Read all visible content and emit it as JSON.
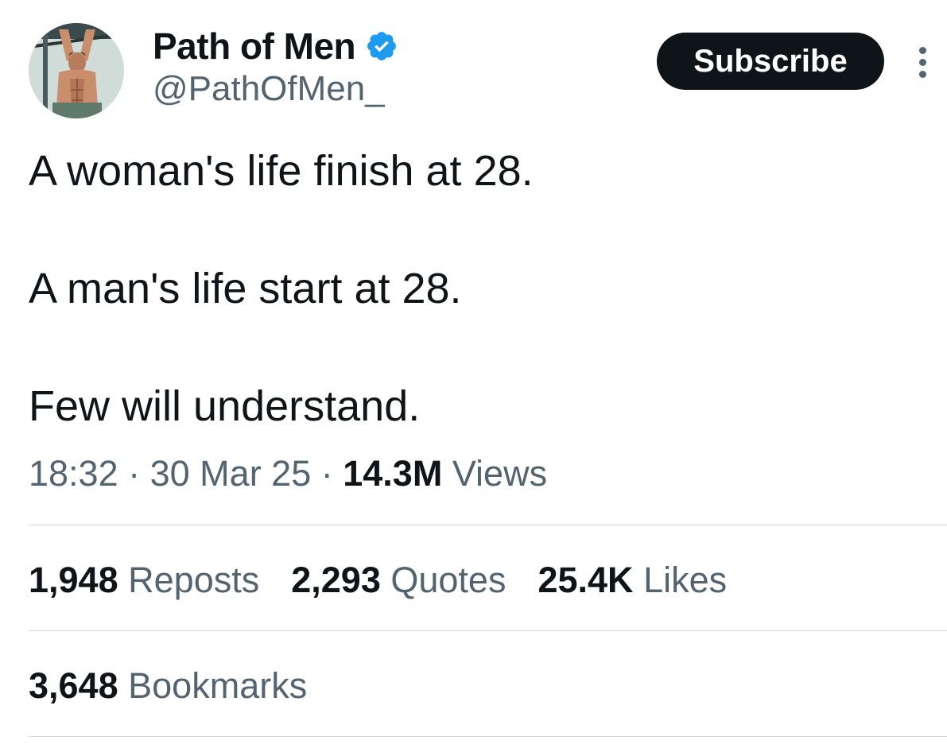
{
  "author": {
    "display_name": "Path of Men",
    "handle": "@PathOfMen_",
    "verified": true,
    "avatar_icon": "profile-photo"
  },
  "subscribe_label": "Subscribe",
  "more_icon": "vertical-ellipsis-icon",
  "tweet": {
    "lines": [
      "A woman's life finish at 28.",
      "A man's life start at 28.",
      "Few will understand."
    ]
  },
  "meta": {
    "time": "18:32",
    "separator1": " · ",
    "date": "30 Mar 25",
    "separator2": " · ",
    "views_count": "14.3M",
    "views_label": "Views"
  },
  "stats": {
    "reposts_count": "1,948",
    "reposts_label": "Reposts",
    "quotes_count": "2,293",
    "quotes_label": "Quotes",
    "likes_count": "25.4K",
    "likes_label": "Likes",
    "bookmarks_count": "3,648",
    "bookmarks_label": "Bookmarks"
  },
  "colors": {
    "text_primary": "#0f1419",
    "text_secondary": "#536471",
    "verified_blue": "#1d9bf0",
    "divider": "#cfd9de",
    "button_bg": "#0f1419"
  }
}
